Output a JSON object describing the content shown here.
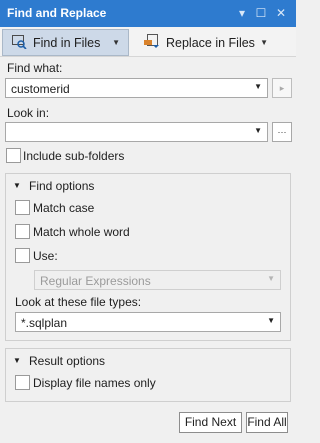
{
  "window": {
    "title": "Find and Replace"
  },
  "tabs": [
    {
      "label": "Find in Files",
      "icon": "find-in-files-icon",
      "active": true
    },
    {
      "label": "Replace in Files",
      "icon": "replace-in-files-icon",
      "active": false
    }
  ],
  "find_what": {
    "label": "Find what:",
    "value": "customerid"
  },
  "look_in": {
    "label": "Look in:",
    "value": "",
    "browse_label": "···"
  },
  "include_subfolders": {
    "label": "Include sub-folders",
    "checked": false
  },
  "find_options": {
    "header": "Find options",
    "match_case": {
      "label": "Match case",
      "checked": false
    },
    "match_whole_word": {
      "label": "Match whole word",
      "checked": false
    },
    "use": {
      "label": "Use:",
      "checked": false
    },
    "use_type": {
      "value": "Regular Expressions"
    },
    "file_types": {
      "label": "Look at these file types:",
      "value": "*.sqlplan"
    }
  },
  "result_options": {
    "header": "Result options",
    "display_file_names_only": {
      "label": "Display file names only",
      "checked": false
    }
  },
  "buttons": {
    "find_next": "Find Next",
    "find_all": "Find All"
  },
  "colors": {
    "title_bar": "#2e7bcf",
    "active_tab": "#cdd9e8"
  }
}
